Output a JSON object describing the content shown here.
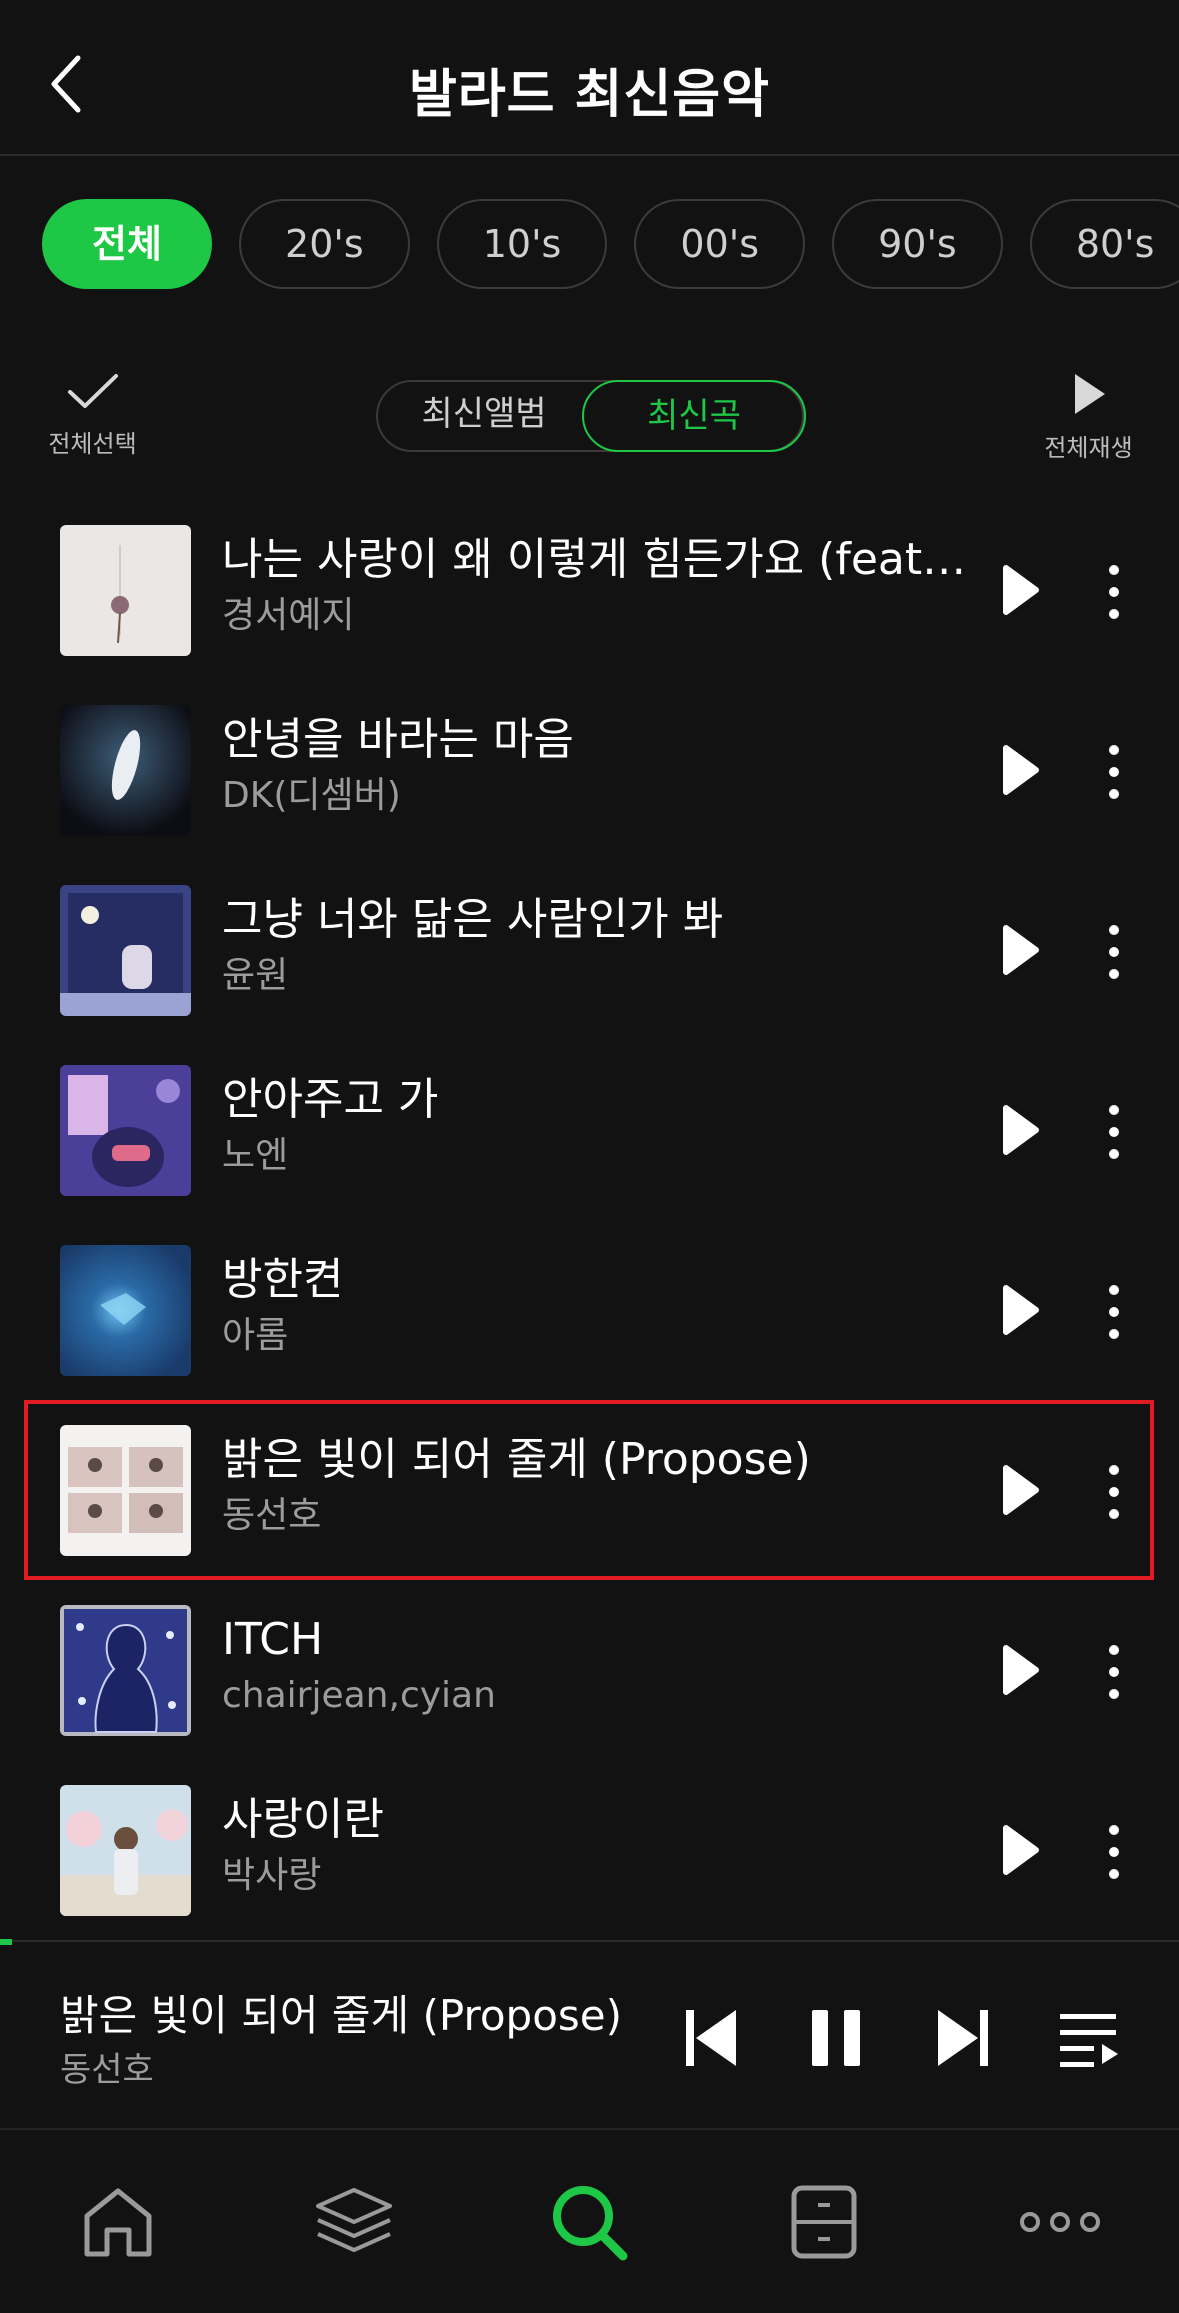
{
  "header": {
    "title": "발라드 최신음악"
  },
  "filters": [
    "전체",
    "20's",
    "10's",
    "00's",
    "90's",
    "80's"
  ],
  "toolbar": {
    "select_all": "전체선택",
    "play_all": "전체재생"
  },
  "segment": {
    "albums": "최신앨범",
    "songs": "최신곡"
  },
  "songs": [
    {
      "title": "나는 사랑이 왜 이렇게 힘든가요 (feat.전…",
      "artist": "경서예지"
    },
    {
      "title": "안녕을 바라는 마음",
      "artist": "DK(디셈버)"
    },
    {
      "title": "그냥 너와 닮은 사람인가 봐",
      "artist": "윤원"
    },
    {
      "title": "안아주고 가",
      "artist": "노엔"
    },
    {
      "title": "방한켠",
      "artist": "아롬"
    },
    {
      "title": "밝은 빛이 되어 줄게 (Propose)",
      "artist": "동선호"
    },
    {
      "title": "ITCH",
      "artist": "chairjean,cyian"
    },
    {
      "title": "사랑이란",
      "artist": "박사랑"
    }
  ],
  "now_playing": {
    "title": "밝은 빛이 되어 줄게 (Propose)",
    "artist": "동선호"
  },
  "colors": {
    "accent": "#1ec745",
    "highlight": "#e21b22",
    "background": "#121212"
  },
  "tabs": [
    "home-icon",
    "layers-icon",
    "search-icon",
    "drawer-icon",
    "more-icon"
  ]
}
